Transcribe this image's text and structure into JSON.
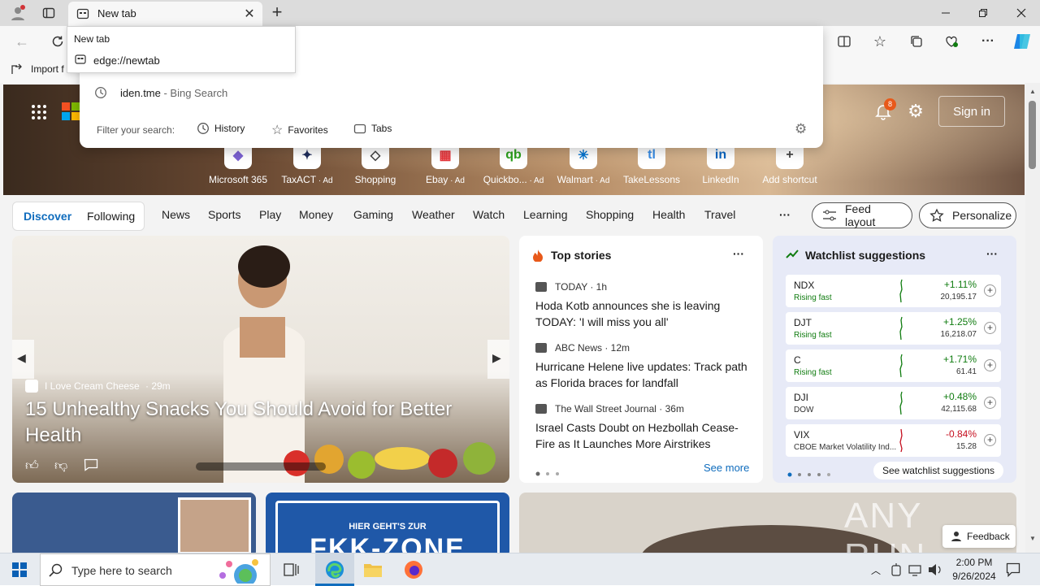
{
  "browser": {
    "tab_title": "New tab",
    "tooltip": {
      "title": "New tab",
      "url": "edge://newtab"
    },
    "favorites_bar": {
      "import_label": "Import f"
    }
  },
  "omnibox": {
    "suggestion": {
      "query": "iden.tme",
      "source": " - Bing Search"
    },
    "filter_label": "Filter your search:",
    "filters": [
      "History",
      "Favorites",
      "Tabs"
    ]
  },
  "ntp": {
    "notification_count": "8",
    "sign_in": "Sign in",
    "shortcuts": [
      {
        "label": "Microsoft 365",
        "ad": "",
        "icon": "microsoft-365-icon",
        "color": "#7b61d1",
        "glyph": "◆"
      },
      {
        "label": "TaxACT",
        "ad": "· Ad",
        "icon": "taxact-icon",
        "color": "#1f2d5c",
        "glyph": "✦"
      },
      {
        "label": "Shopping",
        "ad": "",
        "icon": "shopping-tag-icon",
        "color": "#444",
        "glyph": "◇"
      },
      {
        "label": "Ebay",
        "ad": "· Ad",
        "icon": "ebay-icon",
        "color": "#e53238",
        "glyph": "▦"
      },
      {
        "label": "Quickbo...",
        "ad": "· Ad",
        "icon": "quickbooks-icon",
        "color": "#2ca01c",
        "glyph": "qb"
      },
      {
        "label": "Walmart",
        "ad": "· Ad",
        "icon": "walmart-icon",
        "color": "#0071ce",
        "glyph": "✳"
      },
      {
        "label": "TakeLessons",
        "ad": "",
        "icon": "takelessons-icon",
        "color": "#3a8ee6",
        "glyph": "tl"
      },
      {
        "label": "LinkedIn",
        "ad": "",
        "icon": "linkedin-icon",
        "color": "#0a66c2",
        "glyph": "in"
      },
      {
        "label": "Add shortcut",
        "ad": "",
        "icon": "plus-icon",
        "color": "#444",
        "glyph": "+"
      }
    ],
    "feed_tabs": [
      "Discover",
      "Following"
    ],
    "categories": [
      "News",
      "Sports",
      "Play",
      "Money",
      "Gaming",
      "Weather",
      "Watch",
      "Learning",
      "Shopping",
      "Health",
      "Travel"
    ],
    "more": "···",
    "feed_layout": "Feed layout",
    "personalize": "Personalize"
  },
  "hero_article": {
    "source": "I Love Cream Cheese",
    "age": "· 29m",
    "title": "15 Unhealthy Snacks You Should Avoid for Better Health"
  },
  "top_stories": {
    "heading": "Top stories",
    "items": [
      {
        "source": "TODAY",
        "age": "· 1h",
        "headline": "Hoda Kotb announces she is leaving TODAY: 'I will miss you all'"
      },
      {
        "source": "ABC News",
        "age": "· 12m",
        "headline": "Hurricane Helene live updates: Track path as Florida braces for landfall"
      },
      {
        "source": "The Wall Street Journal",
        "age": "· 36m",
        "headline": "Israel Casts Doubt on Hezbollah Cease-Fire as It Launches More Airstrikes"
      }
    ],
    "see_more": "See more"
  },
  "watchlist": {
    "heading": "Watchlist suggestions",
    "stocks": [
      {
        "symbol": "NDX",
        "sub": "Rising fast",
        "change": "+1.11%",
        "price": "20,195.17",
        "up": true
      },
      {
        "symbol": "DJT",
        "sub": "Rising fast",
        "change": "+1.25%",
        "price": "16,218.07",
        "up": true
      },
      {
        "symbol": "C",
        "sub": "Rising fast",
        "change": "+1.71%",
        "price": "61.41",
        "up": true
      },
      {
        "symbol": "DJI",
        "sub": "DOW",
        "change": "+0.48%",
        "price": "42,115.68",
        "up": true
      },
      {
        "symbol": "VIX",
        "sub": "CBOE Market Volatility Ind...",
        "change": "-0.84%",
        "price": "15.28",
        "up": false
      }
    ],
    "see_all": "See watchlist suggestions"
  },
  "ad_card": {
    "line1": "HIER GEHT'S ZUR",
    "line2": "FKK-ZONE"
  },
  "feedback": "Feedback",
  "watermark": "ANY RUN",
  "taskbar": {
    "search_placeholder": "Type here to search",
    "time": "2:00 PM",
    "date": "9/26/2024"
  },
  "colors": {
    "up": "#107c10",
    "down": "#c50f1f",
    "accent": "#0f6cbd"
  }
}
